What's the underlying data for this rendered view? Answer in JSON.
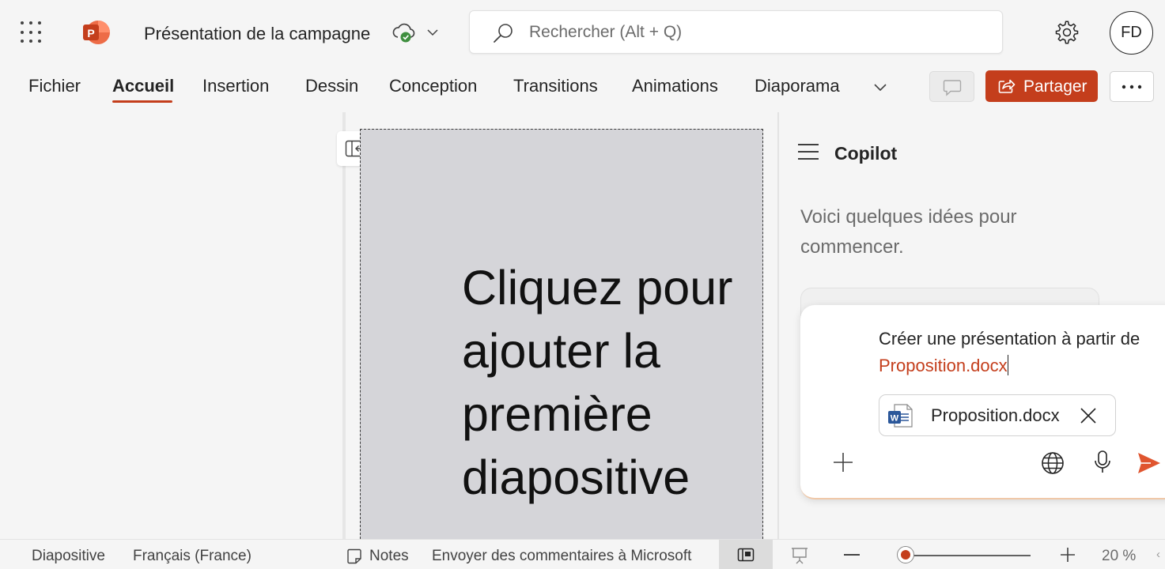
{
  "app": {
    "document_title": "Présentation de la campagne",
    "user_initials": "FD"
  },
  "search": {
    "placeholder": "Rechercher (Alt + Q)"
  },
  "ribbon": {
    "tabs": [
      "Fichier",
      "Accueil",
      "Insertion",
      "Dessin",
      "Conception",
      "Transitions",
      "Animations",
      "Diaporama"
    ],
    "active_tab": "Accueil",
    "share_label": "Partager"
  },
  "slide": {
    "title_placeholder": "Cliquez pour ajouter la première diapositive"
  },
  "copilot": {
    "title": "Copilot",
    "intro": "Voici quelques idées pour commencer.",
    "prompt_text": "Créer une présentation à partir de",
    "prompt_reference": "Proposition.docx",
    "attachment_name": "Proposition.docx"
  },
  "statusbar": {
    "slide_label": "Diapositive",
    "language": "Français (France)",
    "notes_label": "Notes",
    "feedback": "Envoyer des commentaires à Microsoft",
    "zoom_level": "20 %",
    "zoom_fraction": 0.06
  },
  "colors": {
    "accent": "#c43e1c",
    "slide_background": "#d5d5d9",
    "app_background": "#f5f5f5",
    "cloud_status": "#3f8f3f"
  },
  "icons": {
    "app_launcher": "waffle-icon",
    "app_logo": "powerpoint-logo",
    "save_status": "cloud-check-icon",
    "search": "search-icon",
    "settings": "gear-icon",
    "comments": "comment-icon",
    "share": "share-icon",
    "more": "more-icon",
    "collapse": "collapse-pane-icon",
    "copilot_menu": "hamburger-icon",
    "attachment": "word-doc-icon",
    "add": "add-icon",
    "web": "globe-icon",
    "voice": "mic-icon",
    "send": "send-icon"
  }
}
